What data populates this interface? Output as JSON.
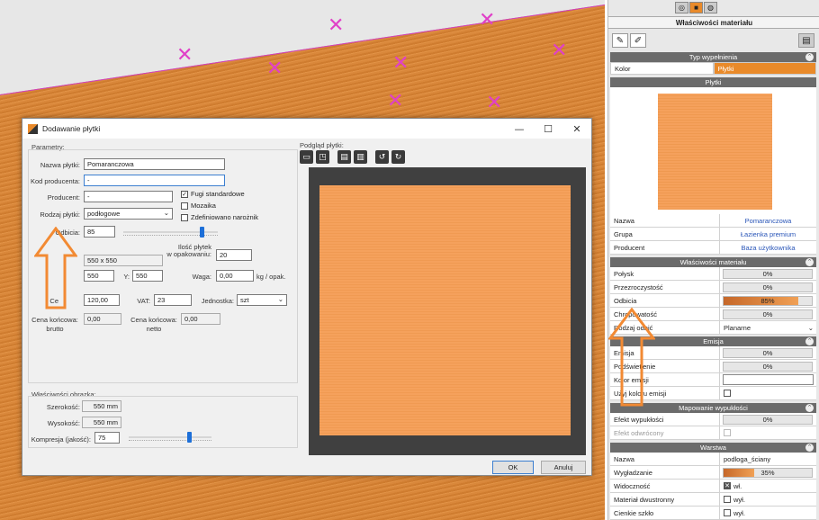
{
  "dialog": {
    "title": "Dodawanie płytki",
    "window_controls": {
      "minimize": "—",
      "maximize": "☐",
      "close": "✕"
    },
    "params_group": "Parametry:",
    "fields": {
      "nazwa_label": "Nazwa płytki:",
      "nazwa_value": "Pomaranczowa",
      "kod_label": "Kod producenta:",
      "kod_value": "-",
      "producent_label": "Producent:",
      "producent_value": "-",
      "rodzaj_label": "Rodzaj płytki:",
      "rodzaj_value": "podłogowe",
      "odbicia_label": "Odbicia:",
      "odbicia_value": "85",
      "size_value": "550 x 550",
      "x_value": "550",
      "y_label": "Y:",
      "y_value": "550",
      "ilosc_label": "Ilość płytek\nw opakowaniu:",
      "ilosc_value": "20",
      "waga_label": "Waga:",
      "waga_value": "0,00",
      "waga_unit": "kg / opak.",
      "cena_label": "Ce",
      "cena_value": "120,00",
      "vat_label": "VAT:",
      "vat_value": "23",
      "jednostka_label": "Jednostka:",
      "jednostka_value": "szt",
      "cena_brutto_label": "Cena końcowa:\nbrutto",
      "cena_brutto_value": "0,00",
      "cena_netto_label": "Cena końcowa:\nnetto",
      "cena_netto_value": "0,00"
    },
    "checkboxes": {
      "fugi": "Fugi standardowe",
      "fugi_checked": "✓",
      "mozaika": "Mozaika",
      "zdef": "Zdefiniowano narożnik"
    },
    "odbicia_slider": 0.85,
    "image_group": "Właściwości obrazka:",
    "image": {
      "szer_label": "Szerokość:",
      "szer_value": "550 mm",
      "wys_label": "Wysokość:",
      "wys_value": "550 mm",
      "kompresja_label": "Kompresja (jakość):",
      "kompresja_value": "75"
    },
    "kompresja_slider": 0.75,
    "preview_label": "Podgląd płytki:",
    "buttons": {
      "ok": "OK",
      "cancel": "Anuluj"
    }
  },
  "panel": {
    "title": "Właściwości materiału",
    "typ_header": "Typ wypełnienia",
    "typ_options": [
      "Kolor",
      "Płytki"
    ],
    "plytki_header": "Płytki",
    "info": [
      {
        "k": "Nazwa",
        "v": "Pomaranczowa"
      },
      {
        "k": "Grupa",
        "v": "Łazienka premium"
      },
      {
        "k": "Producent",
        "v": "Baza użytkownika"
      }
    ],
    "material_header": "Właściwości materiału",
    "material": [
      {
        "k": "Połysk",
        "v": "0%",
        "fill": 0
      },
      {
        "k": "Przezroczystość",
        "v": "0%",
        "fill": 0
      },
      {
        "k": "Odbicia",
        "v": "85%",
        "fill": 0.85
      },
      {
        "k": "Chropowatość",
        "v": "0%",
        "fill": 0
      }
    ],
    "odbic_label": "Rodzaj odbić",
    "odbic_value": "Planarne",
    "emisja_header": "Emisja",
    "emisja": [
      {
        "k": "Emisja",
        "v": "0%"
      },
      {
        "k": "Podświetlenie",
        "v": "0%"
      }
    ],
    "kolor_emisji": "Kolor emisji",
    "uzyj_koloru": "Użyj koloru emisji",
    "mapowanie_header": "Mapowanie wypukłości",
    "efekt_wypuklosci": "Efekt wypukłości",
    "efekt_wypuklosci_v": "0%",
    "efekt_odwrocony": "Efekt odwrócony",
    "warstwa_header": "Warstwa",
    "warstwa_nazwa_k": "Nazwa",
    "warstwa_nazwa_v": "podloga_ściany",
    "wygladzanie_k": "Wygładzanie",
    "wygladzanie_v": "35%",
    "wygladzanie_fill": 0.35,
    "widocznosc_k": "Widoczność",
    "widocznosc_v": "wł.",
    "dwustronny_k": "Materiał dwustronny",
    "dwustronny_v": "wył.",
    "cienkie_k": "Cienkie szkło",
    "cienkie_v": "wył."
  },
  "colors": {
    "accent": "#e98a2a",
    "arrow": "#f28a33",
    "grid": "#e040c8"
  }
}
